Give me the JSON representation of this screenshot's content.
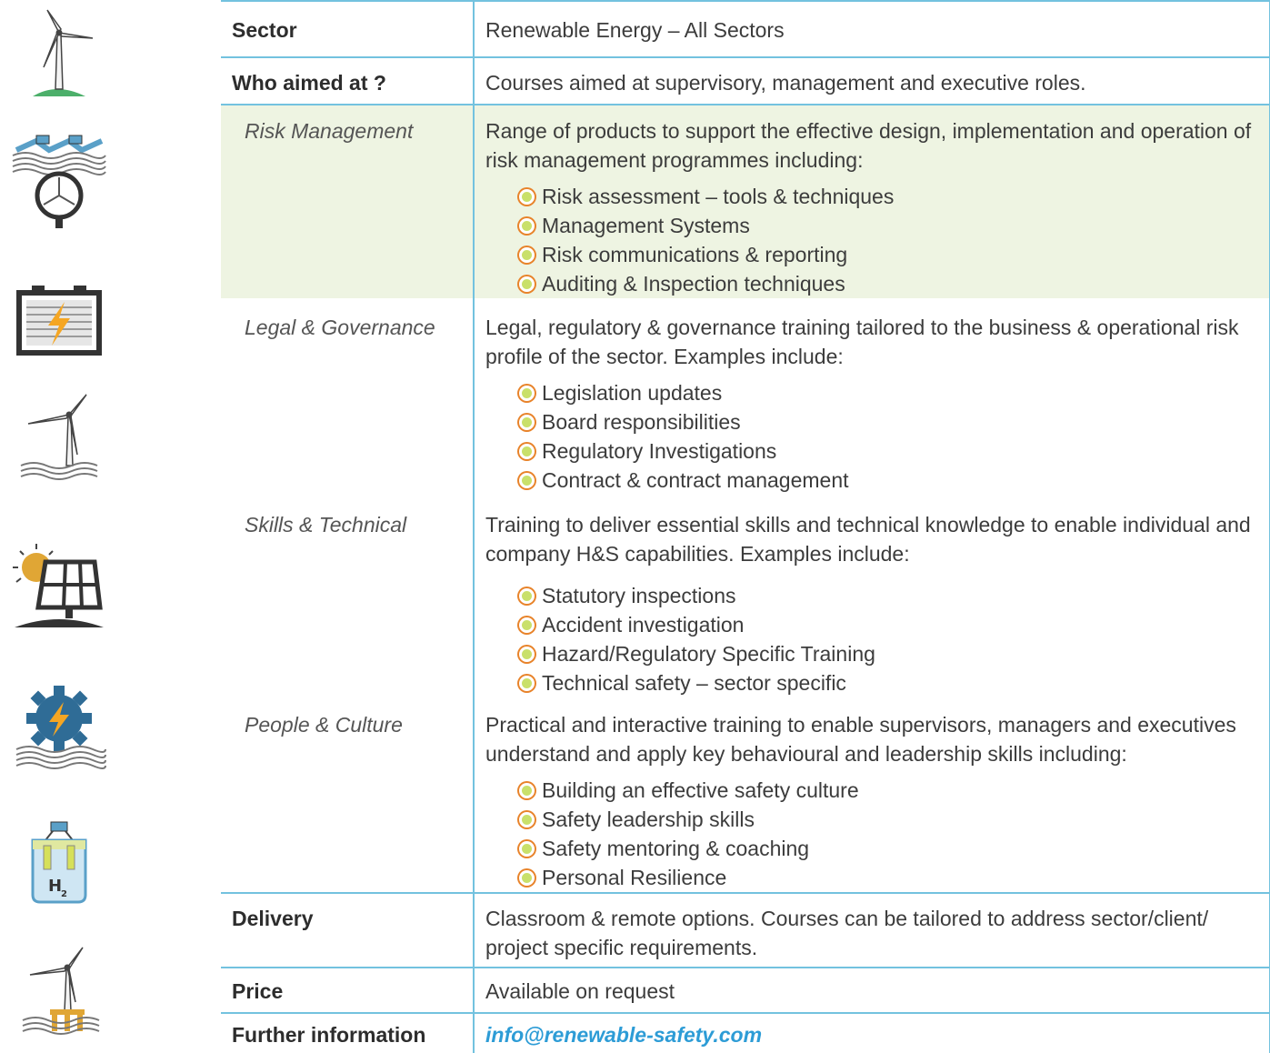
{
  "colors": {
    "border": "#73c2df",
    "highlight_row": "#eef4e2",
    "email": "#2d9cd6",
    "bullet_ring": "#e8832a",
    "bullet_fill": "#c9e06a"
  },
  "icons": [
    "wind-turbine-icon",
    "tidal-turbine-icon",
    "battery-storage-icon",
    "offshore-wind-icon",
    "solar-panel-icon",
    "hydro-wheel-icon",
    "hydrogen-electrolyser-icon",
    "floating-wind-icon"
  ],
  "table": {
    "sector": {
      "label": "Sector",
      "value": "Renewable Energy – All Sectors"
    },
    "audience": {
      "label": "Who aimed at ?",
      "value": "Courses aimed at supervisory, management and executive roles."
    },
    "risk": {
      "label": "Risk Management",
      "intro": "Range of products to support the effective design, implementation and operation of risk management programmes including:",
      "items": [
        "Risk assessment – tools & techniques",
        "Management Systems",
        "Risk communications & reporting",
        "Auditing & Inspection techniques"
      ]
    },
    "legal": {
      "label": "Legal & Governance",
      "intro": "Legal, regulatory & governance training tailored to the business & operational risk profile of the sector. Examples include:",
      "items": [
        "Legislation updates",
        "Board responsibilities",
        "Regulatory Investigations",
        "Contract & contract management"
      ]
    },
    "skills": {
      "label": "Skills & Technical",
      "intro": "Training to deliver essential skills and technical knowledge to enable individual and company H&S capabilities. Examples include:",
      "items": [
        "Statutory inspections",
        "Accident investigation",
        "Hazard/Regulatory Specific Training",
        "Technical safety – sector specific"
      ]
    },
    "people": {
      "label": "People & Culture",
      "intro": "Practical and interactive training to enable supervisors, managers and executives understand and apply key behavioural and leadership skills including:",
      "items": [
        "Building an effective safety culture",
        "Safety leadership skills",
        "Safety mentoring & coaching",
        "Personal Resilience"
      ]
    },
    "delivery": {
      "label": "Delivery",
      "value": "Classroom & remote options. Courses can be tailored to address sector/client/ project specific requirements."
    },
    "price": {
      "label": "Price",
      "value": "Available on request"
    },
    "info": {
      "label": "Further information",
      "value": "info@renewable-safety.com"
    }
  }
}
